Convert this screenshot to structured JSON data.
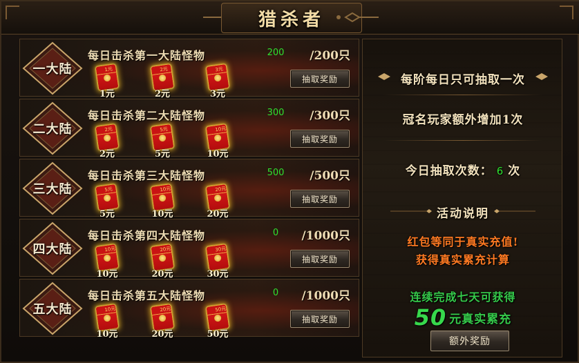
{
  "window": {
    "title": "猎杀者"
  },
  "rows": [
    {
      "badge": "一大陆",
      "title": "每日击杀第一大陆怪物",
      "count": "200",
      "target": "/200只",
      "button": "抽取奖励",
      "packets": [
        {
          "tag": "1元",
          "amount": "1元"
        },
        {
          "tag": "2元",
          "amount": "2元"
        },
        {
          "tag": "3元",
          "amount": "3元"
        }
      ]
    },
    {
      "badge": "二大陆",
      "title": "每日击杀第二大陆怪物",
      "count": "300",
      "target": "/300只",
      "button": "抽取奖励",
      "packets": [
        {
          "tag": "2元",
          "amount": "2元"
        },
        {
          "tag": "5元",
          "amount": "5元"
        },
        {
          "tag": "10元",
          "amount": "10元"
        }
      ]
    },
    {
      "badge": "三大陆",
      "title": "每日击杀第三大陆怪物",
      "count": "500",
      "target": "/500只",
      "button": "抽取奖励",
      "packets": [
        {
          "tag": "5元",
          "amount": "5元"
        },
        {
          "tag": "10元",
          "amount": "10元"
        },
        {
          "tag": "20元",
          "amount": "20元"
        }
      ]
    },
    {
      "badge": "四大陆",
      "title": "每日击杀第四大陆怪物",
      "count": "0",
      "target": "/1000只",
      "button": "抽取奖励",
      "packets": [
        {
          "tag": "10元",
          "amount": "10元"
        },
        {
          "tag": "20元",
          "amount": "20元"
        },
        {
          "tag": "30元",
          "amount": "30元"
        }
      ]
    },
    {
      "badge": "五大陆",
      "title": "每日击杀第五大陆怪物",
      "count": "0",
      "target": "/1000只",
      "button": "抽取奖励",
      "packets": [
        {
          "tag": "10元",
          "amount": "10元"
        },
        {
          "tag": "20元",
          "amount": "20元"
        },
        {
          "tag": "50元",
          "amount": "50元"
        }
      ]
    }
  ],
  "side": {
    "line1": "每阶每日只可抽取一次",
    "line2": "冠名玩家额外增加1次",
    "draws_label": "今日抽取次数：",
    "draws_value": "6",
    "draws_unit": "次",
    "rules_title": "活动说明",
    "rules_1": "红包等同于真实充值!",
    "rules_2": "获得真实累充计算",
    "bonus_1": "连续完成七天可获得",
    "bonus_amount": "50",
    "bonus_suffix": "元真实累充",
    "bonus_button": "额外奖励"
  },
  "colors": {
    "gold_text": "#f3e2bd",
    "count_green": "#2fe02f",
    "warning_orange": "#ff7a22",
    "bonus_green": "#35c94a",
    "envelope_red": "#e01b1b"
  }
}
